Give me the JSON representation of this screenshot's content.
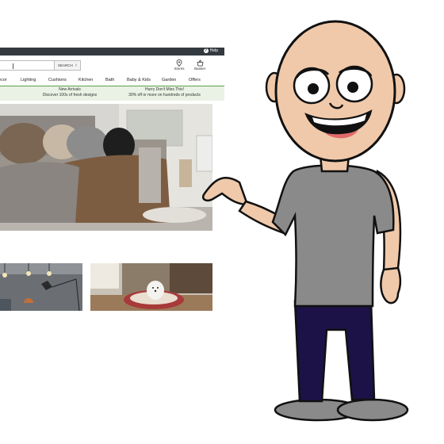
{
  "help": {
    "label": "Help"
  },
  "search": {
    "button_label": "SEARCH",
    "placeholder": ""
  },
  "utilities": [
    {
      "label": "Stores",
      "icon": "location-pin-icon"
    },
    {
      "label": "Basket",
      "icon": "basket-icon"
    }
  ],
  "nav": {
    "items": [
      "ecor",
      "Lighting",
      "Cushions",
      "Kitchen",
      "Bath",
      "Baby & Kids",
      "Garden",
      "Offers"
    ]
  },
  "promo": {
    "left": {
      "title": "New Arrivals",
      "subtitle": "Discover 100s of fresh designs"
    },
    "right": {
      "title": "Hurry Don't Miss This!",
      "subtitle": "30% off or more on hundreds of products"
    }
  },
  "colors": {
    "topbar": "#333a3f",
    "promo_bg": "#e9f2e4",
    "promo_accent": "#5aa04e",
    "shirt": "#8a8a8a",
    "trousers": "#1c1247",
    "skin": "#f0c9aa"
  }
}
